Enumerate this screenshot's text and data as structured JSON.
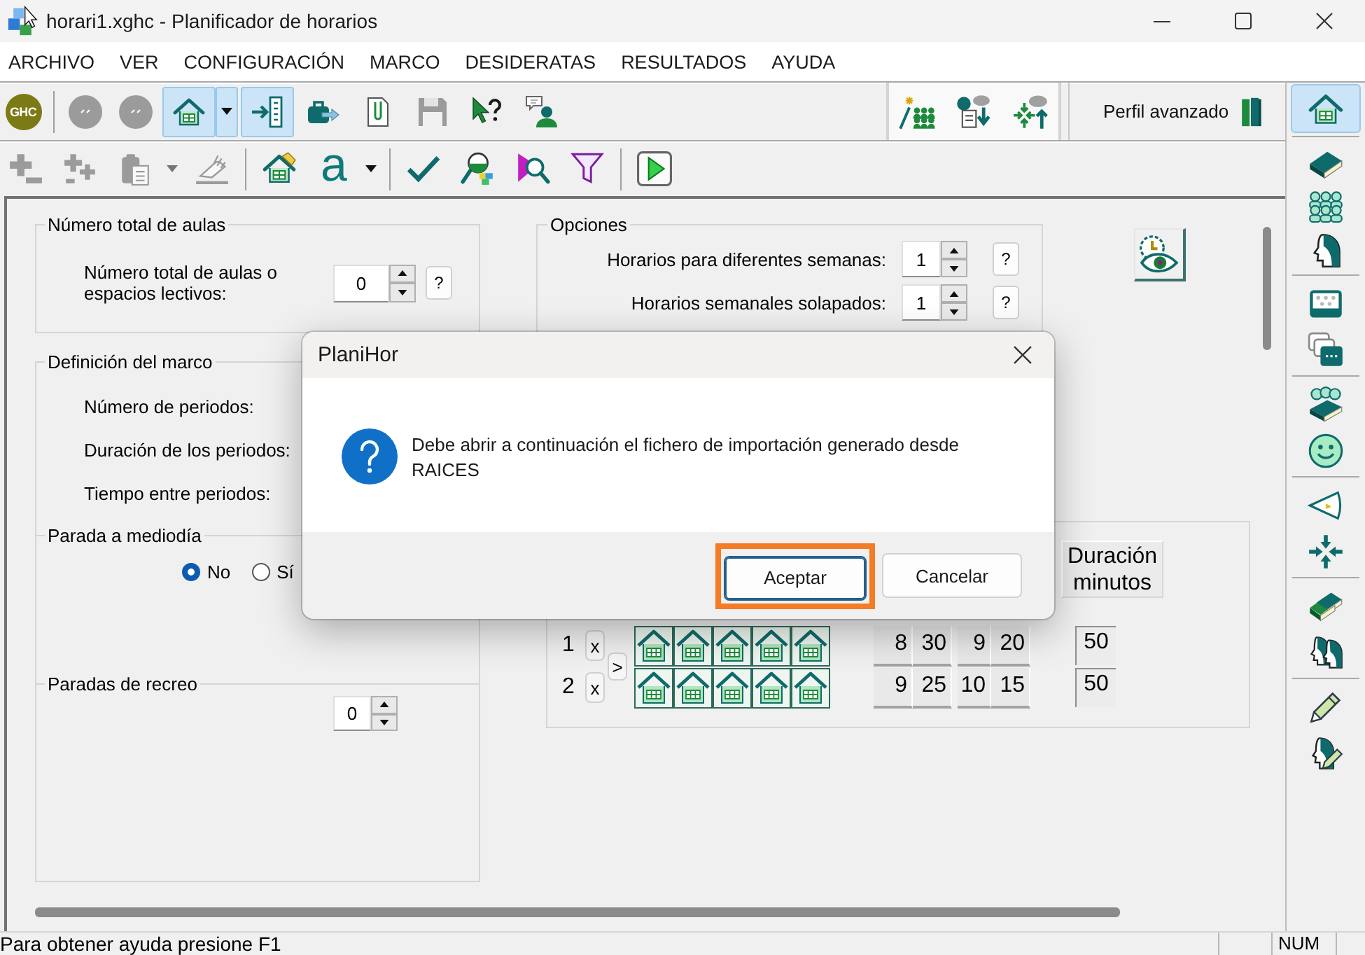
{
  "window": {
    "title": "horari1.xghc - Planificador de horarios"
  },
  "menu": [
    "ARCHIVO",
    "VER",
    "CONFIGURACIÓN",
    "MARCO",
    "DESIDERATAS",
    "RESULTADOS",
    "AYUDA"
  ],
  "toolbar_main": {
    "groups": [
      [
        {
          "kind": "logo",
          "text": "GHC",
          "pressed": false,
          "disabled": false
        }
      ],
      [
        {
          "kind": "circle",
          "pressed": false,
          "disabled": true
        },
        {
          "kind": "circle",
          "pressed": false,
          "disabled": true
        },
        {
          "kind": "home",
          "pressed": true,
          "disabled": false
        },
        {
          "kind": "caret",
          "pressed": true,
          "disabled": false
        },
        {
          "kind": "import",
          "pressed": true,
          "disabled": false
        },
        {
          "kind": "briefcase",
          "pressed": false,
          "disabled": false
        },
        {
          "kind": "clip",
          "pressed": false,
          "disabled": false
        },
        {
          "kind": "save",
          "pressed": false,
          "disabled": true
        },
        {
          "kind": "help",
          "pressed": false,
          "disabled": false
        },
        {
          "kind": "person-chat",
          "pressed": false,
          "disabled": false
        }
      ]
    ]
  },
  "toolbar_views": {
    "items": [
      {
        "kind": "people-wand"
      },
      {
        "kind": "person-doc"
      },
      {
        "kind": "arrows-cloud"
      }
    ]
  },
  "profile": {
    "label": "Perfil avanzado"
  },
  "toolbar_edit": {
    "groups": [
      [
        {
          "kind": "plus",
          "disabled": true
        },
        {
          "kind": "plus-pair",
          "disabled": true
        },
        {
          "kind": "clipboard",
          "disabled": true
        },
        {
          "kind": "caret",
          "disabled": true
        },
        {
          "kind": "hand",
          "disabled": true
        }
      ],
      [
        {
          "kind": "house-hand",
          "disabled": false
        },
        {
          "kind": "font",
          "text": "a",
          "disabled": false
        },
        {
          "kind": "caret",
          "disabled": false
        }
      ],
      [
        {
          "kind": "check",
          "disabled": false
        },
        {
          "kind": "magnifier",
          "disabled": false
        },
        {
          "kind": "magnifier-triangle",
          "disabled": false
        },
        {
          "kind": "filter",
          "disabled": false
        }
      ],
      [
        {
          "kind": "play",
          "disabled": false
        }
      ]
    ]
  },
  "side_toolbar": {
    "groups": [
      [
        {
          "kind": "home",
          "pressed": true
        }
      ],
      [
        {
          "kind": "book",
          "pressed": false
        },
        {
          "kind": "people",
          "pressed": false
        },
        {
          "kind": "head",
          "pressed": false
        }
      ],
      [
        {
          "kind": "screen",
          "pressed": false
        },
        {
          "kind": "screens",
          "pressed": false
        }
      ],
      [
        {
          "kind": "people-book",
          "pressed": false
        },
        {
          "kind": "smiley",
          "pressed": false
        }
      ],
      [
        {
          "kind": "triangle",
          "pressed": false
        },
        {
          "kind": "arrows-in",
          "pressed": false
        }
      ],
      [
        {
          "kind": "books-stack",
          "pressed": false
        },
        {
          "kind": "heads",
          "pressed": false
        }
      ],
      [
        {
          "kind": "pencil",
          "pressed": false
        },
        {
          "kind": "head-pencil",
          "pressed": false
        }
      ]
    ]
  },
  "rooms_group": {
    "title": "Número total de aulas",
    "label": "Número total de aulas o espacios lectivos:",
    "value": "0",
    "help": "?"
  },
  "frame_group": {
    "title": "Definición del marco",
    "fields": [
      "Número de periodos:",
      "Duración de los periodos:",
      "Tiempo entre periodos:"
    ],
    "midday": {
      "title": "Parada a mediodía",
      "options": [
        {
          "label": "No",
          "selected": true
        },
        {
          "label": "Sí",
          "selected": false
        }
      ]
    },
    "breaks": {
      "title": "Paradas de recreo",
      "value": "0"
    }
  },
  "options_group": {
    "title": "Opciones",
    "rows": [
      {
        "label": "Horarios para diferentes semanas:",
        "value": "1",
        "help": "?"
      },
      {
        "label": "Horarios semanales solapados:",
        "value": "1",
        "help": "?"
      }
    ]
  },
  "frame_table": {
    "duration_header": "Duración minutos",
    "move_button": ">",
    "rows": [
      {
        "number": "1",
        "remove": "x",
        "start_hour": "8",
        "start_minute": "30",
        "end_hour": "9",
        "end_minute": "20",
        "duration": "50"
      },
      {
        "number": "2",
        "remove": "x",
        "start_hour": "9",
        "start_minute": "25",
        "end_hour": "10",
        "end_minute": "15",
        "duration": "50"
      }
    ]
  },
  "dialog": {
    "title": "PlaniHor",
    "message": "Debe abrir a continuación el fichero de importación generado desde RAICES",
    "buttons": [
      {
        "label": "Aceptar",
        "default": true,
        "highlighted": true
      },
      {
        "label": "Cancelar",
        "default": false,
        "highlighted": false
      }
    ]
  },
  "status_bar": {
    "message": "Para obtener ayuda presione F1",
    "indicators": [
      "NUM"
    ]
  }
}
